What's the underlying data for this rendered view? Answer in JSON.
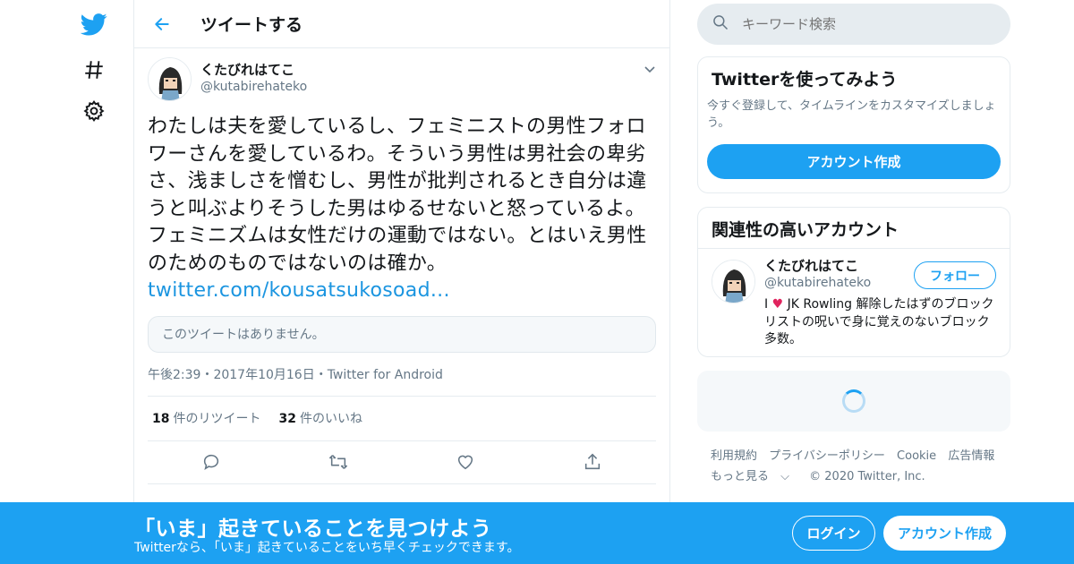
{
  "header": {
    "title": "ツイートする"
  },
  "tweet": {
    "author_name": "くたびれはてこ",
    "author_handle": "@kutabirehateko",
    "text": "わたしは夫を愛しているし、フェミニストの男性フォロワーさんを愛しているわ。そういう男性は男社会の卑劣さ、浅ましさを憎むし、男性が批判されるとき自分は違うと叫ぶよりそうした男はゆるせないと怒っているよ。フェミニズムは女性だけの運動ではない。とはいえ男性のためのものではないのは確か。",
    "link": "twitter.com/kousatsukosoad...",
    "quote_unavailable": "このツイートはありません。",
    "meta": "午後2:39・2017年10月16日・Twitter for Android",
    "retweets": "18",
    "retweets_label": "件のリツイート",
    "likes": "32",
    "likes_label": "件のいいね"
  },
  "search": {
    "placeholder": "キーワード検索"
  },
  "signup_card": {
    "title": "Twitterを使ってみよう",
    "subtitle": "今すぐ登録して、タイムラインをカスタマイズしましょう。",
    "button": "アカウント作成"
  },
  "related_card": {
    "title": "関連性の高いアカウント",
    "name": "くたびれはてこ",
    "handle": "@kutabirehateko",
    "follow": "フォロー",
    "bio_prefix": "I",
    "bio_heart": "♥",
    "bio_rest": "JK Rowling 解除したはずのブロックリストの呪いで身に覚えのないブロック多数。"
  },
  "footer": {
    "links": [
      "利用規約",
      "プライバシーポリシー",
      "Cookie",
      "広告情報"
    ],
    "more": "もっと見る",
    "copyright": "© 2020 Twitter, Inc."
  },
  "banner": {
    "title": "「いま」起きていることを見つけよう",
    "subtitle": "Twitterなら、「いま」起きていることをいち早くチェックできます。",
    "login": "ログイン",
    "signup": "アカウント作成"
  },
  "colors": {
    "brand": "#1da1f2",
    "link": "#1b95e0",
    "heart": "#e0245e"
  }
}
